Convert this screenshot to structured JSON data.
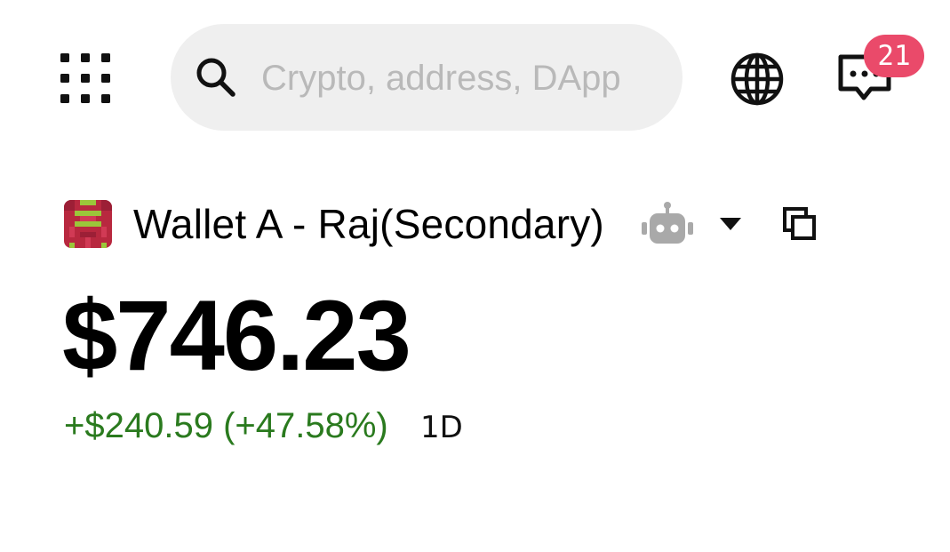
{
  "header": {
    "search": {
      "placeholder": "Crypto, address, DApp",
      "value": ""
    },
    "notifications": {
      "count": "21"
    }
  },
  "icons": {
    "apps": "grid-menu-icon",
    "search": "search-icon",
    "globe": "globe-icon",
    "chat": "chat-icon",
    "robot": "robot-icon",
    "dropdown": "caret-down-icon",
    "copy": "copy-icon"
  },
  "wallet": {
    "name": "Wallet A - Raj(Secondary)",
    "balance": "$746.23",
    "change": "+$240.59 (+47.58%)",
    "period": "1D"
  },
  "colors": {
    "positive": "#2a7a1e",
    "badge": "#ea4a6a",
    "search_bg": "#efefef",
    "avatar_primary": "#b8283f",
    "avatar_accent": "#9bc63a"
  }
}
